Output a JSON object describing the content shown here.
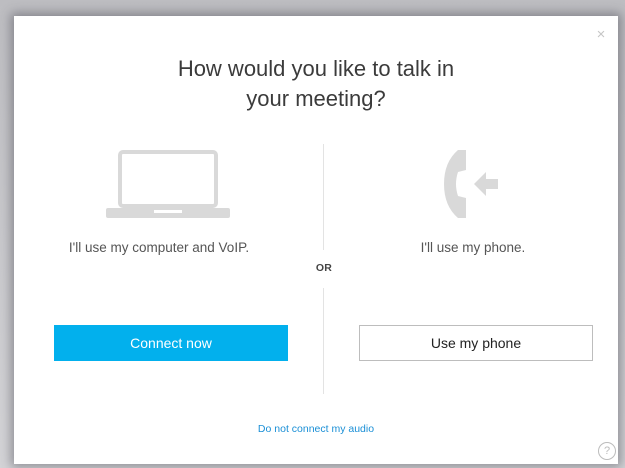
{
  "dialog": {
    "close_glyph": "×",
    "title_line1": "How would you like to talk in",
    "title_line2": "your meeting?",
    "computer_option": {
      "icon": "laptop-icon",
      "text": "I'll use my computer and VoIP.",
      "button_label": "Connect now"
    },
    "separator_label": "OR",
    "phone_option": {
      "icon": "phone-callback-icon",
      "text": "I'll use my phone.",
      "button_label": "Use my phone"
    },
    "no_audio_link": "Do not connect my audio",
    "help_glyph": "?"
  },
  "colors": {
    "primary_button": "#02b0ed",
    "link": "#1a8fd6",
    "icon_gray": "#d9d9d9"
  }
}
